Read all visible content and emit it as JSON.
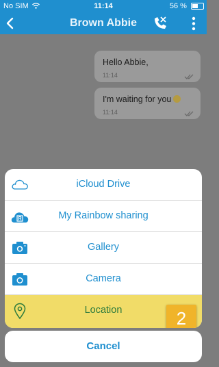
{
  "status_bar": {
    "carrier": "No SIM",
    "time": "11:14",
    "battery": "56 %"
  },
  "nav": {
    "title": "Brown Abbie"
  },
  "messages": [
    {
      "text": "Hello Abbie,",
      "time": "11:14"
    },
    {
      "text": "I'm waiting for you",
      "time": "11:14"
    }
  ],
  "action_sheet": {
    "options": [
      {
        "label": "iCloud Drive",
        "icon": "cloud-icon"
      },
      {
        "label": "My Rainbow sharing",
        "icon": "rainbow-sharing-icon"
      },
      {
        "label": "Gallery",
        "icon": "gallery-camera-icon"
      },
      {
        "label": "Camera",
        "icon": "camera-icon"
      },
      {
        "label": "Location",
        "icon": "location-pin-icon",
        "highlighted": true
      }
    ],
    "cancel_label": "Cancel"
  },
  "annotation": {
    "step_number": "2"
  },
  "colors": {
    "brand_blue": "#1f8fcf",
    "highlight_yellow": "#f1dc68",
    "badge_orange": "#f0b42a"
  }
}
